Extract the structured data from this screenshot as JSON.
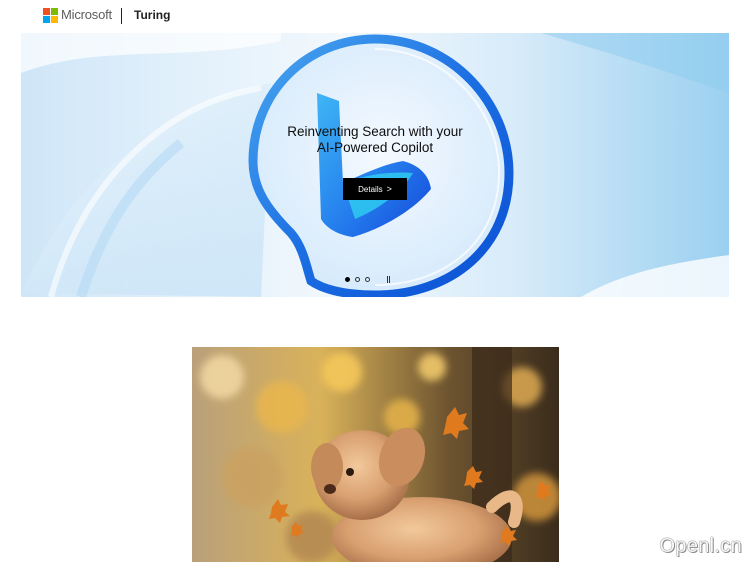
{
  "header": {
    "brand": "Microsoft",
    "product": "Turing",
    "logo_colors": [
      "#f25022",
      "#7fba00",
      "#00a4ef",
      "#ffb900"
    ]
  },
  "hero": {
    "title": "Reinventing Search with your\nAI-Powered Copilot",
    "details_label": "Details",
    "details_chevron": ">",
    "carousel": {
      "slides": 3,
      "active_index": 0
    },
    "icon": "bing-copilot-logo",
    "accent": "#1a6fe0"
  },
  "photo": {
    "subject": "fluffy-dog-autumn-leaves"
  },
  "watermark": {
    "text": "Openl.cn"
  }
}
